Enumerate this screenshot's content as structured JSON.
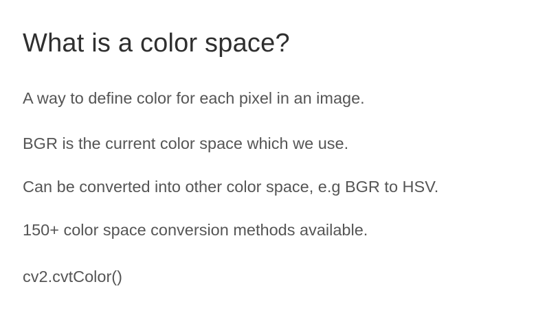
{
  "slide": {
    "title": "What is a color space?",
    "points": [
      "A way to define color for each pixel in an image.",
      "BGR is the current color space which we use.",
      "Can be converted into other color space, e.g BGR to HSV.",
      "150+ color space conversion methods available.",
      "cv2.cvtColor()"
    ]
  }
}
